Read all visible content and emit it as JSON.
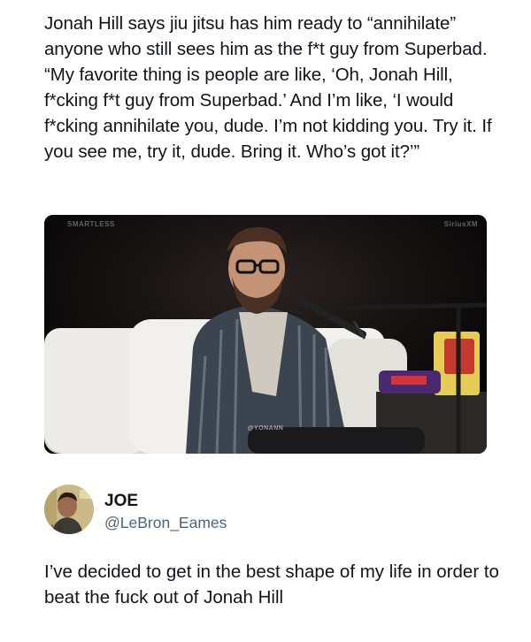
{
  "post": {
    "text": "Jonah Hill says jiu jitsu has him ready to “annihilate” anyone who still sees him as the f*t guy from Superbad. “My favorite thing is people are like, ‘Oh, Jonah Hill, f*cking f*t guy from Superbad.’ And I’m like, ‘I would f*cking annihilate you, dude. I’m not kidding you. Try it. If you see me, try it, dude. Bring it. Who’s got it?’”"
  },
  "media": {
    "watermark_left": "SMARTLESS",
    "watermark_right": "SiriusXM",
    "watermark_center": "@YONANN"
  },
  "reply": {
    "name": "JOE",
    "handle": "@LeBron_Eames",
    "text": "I’ve decided to get in the best shape of my life in order to beat the fuck out of Jonah Hill"
  }
}
